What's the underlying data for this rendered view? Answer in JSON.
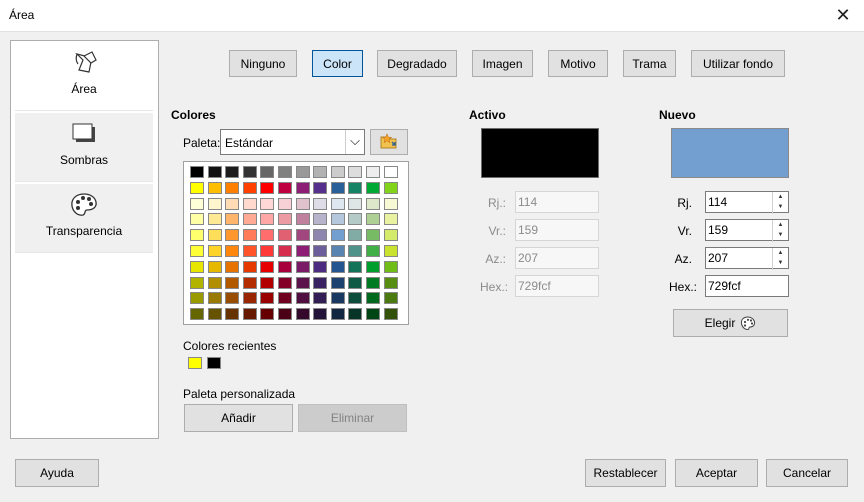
{
  "window": {
    "title": "Área",
    "close_glyph": "✕"
  },
  "sidebar": {
    "items": [
      {
        "label": "Área",
        "icon": "area-fill-icon"
      },
      {
        "label": "Sombras",
        "icon": "shadow-icon"
      },
      {
        "label": "Transparencia",
        "icon": "palette-transparency-icon"
      }
    ]
  },
  "tabs": [
    "Ninguno",
    "Color",
    "Degradado",
    "Imagen",
    "Motivo",
    "Trama",
    "Utilizar fondo"
  ],
  "colores": {
    "heading": "Colores",
    "palette_label": "Paleta:",
    "palette_value": "Estándar",
    "dropdown_glyph": "⌵",
    "recent_label": "Colores recientes",
    "custom_label": "Paleta personalizada",
    "add_label": "Añadir",
    "remove_label": "Eliminar",
    "palette_rows": [
      [
        "#000000",
        "#111111",
        "#1c1c1c",
        "#333333",
        "#666666",
        "#808080",
        "#999999",
        "#b2b2b2",
        "#cccccc",
        "#dddddd",
        "#eeeeee",
        "#ffffff"
      ],
      [
        "#ffff00",
        "#ffbf00",
        "#ff8000",
        "#ff4000",
        "#ff0000",
        "#bf0041",
        "#8d1d75",
        "#55308d",
        "#2a6099",
        "#158466",
        "#00a933",
        "#81d41a"
      ],
      [
        "#ffffd7",
        "#fff5ce",
        "#ffdbb6",
        "#ffd8ce",
        "#ffd7d7",
        "#f7d1d5",
        "#e0c2cd",
        "#dedce6",
        "#dee6ef",
        "#dee7e5",
        "#dde8cb",
        "#f6f9d4"
      ],
      [
        "#ffffa6",
        "#ffe994",
        "#ffb66c",
        "#ffaa95",
        "#ffa6a6",
        "#ec9ba4",
        "#bf819e",
        "#b7b3ca",
        "#b4c7dc",
        "#b3cac7",
        "#afd095",
        "#e8f2a1"
      ],
      [
        "#ffff6d",
        "#ffde59",
        "#ff972f",
        "#ff7b59",
        "#ff6d6d",
        "#e16173",
        "#a1467e",
        "#8e86ae",
        "#729fcf",
        "#81aca6",
        "#77bc65",
        "#d4ea6b"
      ],
      [
        "#ffff38",
        "#ffd428",
        "#ff860d",
        "#ff5429",
        "#ff3838",
        "#d62e4e",
        "#8d1d75",
        "#6b5e9b",
        "#5983b0",
        "#50938a",
        "#3faf46",
        "#c9e22d"
      ],
      [
        "#e6e600",
        "#e6b800",
        "#e67300",
        "#e63900",
        "#e60000",
        "#a8003a",
        "#7b1a66",
        "#4b2c80",
        "#245591",
        "#127359",
        "#009e2d",
        "#70bd17"
      ],
      [
        "#b2b200",
        "#b28f00",
        "#b25900",
        "#b22c00",
        "#b20000",
        "#830028",
        "#5c134c",
        "#3a2363",
        "#1d4270",
        "#0e5a45",
        "#007a23",
        "#578e12"
      ],
      [
        "#999900",
        "#997a00",
        "#994d00",
        "#992600",
        "#990000",
        "#70001f",
        "#4f1041",
        "#321e55",
        "#193960",
        "#0c4d3b",
        "#00691e",
        "#4a7a0f"
      ],
      [
        "#666600",
        "#665200",
        "#663300",
        "#661a00",
        "#660000",
        "#4b0015",
        "#35092b",
        "#221439",
        "#112640",
        "#083327",
        "#004614",
        "#325109"
      ]
    ],
    "recent_colors": [
      "#ffff00",
      "#000000"
    ]
  },
  "activo": {
    "heading": "Activo",
    "swatch_color": "#000000",
    "r_label": "Rj.:",
    "r_value": "114",
    "g_label": "Vr.:",
    "g_value": "159",
    "b_label": "Az.:",
    "b_value": "207",
    "hex_label": "Hex.:",
    "hex_value": "729fcf"
  },
  "nuevo": {
    "heading": "Nuevo",
    "swatch_color": "#729fcf",
    "r_label": "Rj.",
    "r_value": "114",
    "g_label": "Vr.",
    "g_value": "159",
    "b_label": "Az.",
    "b_value": "207",
    "hex_label": "Hex.:",
    "hex_value": "729fcf",
    "pick_label": "Elegir"
  },
  "footer": {
    "help": "Ayuda",
    "reset": "Restablecer",
    "ok": "Aceptar",
    "cancel": "Cancelar"
  }
}
